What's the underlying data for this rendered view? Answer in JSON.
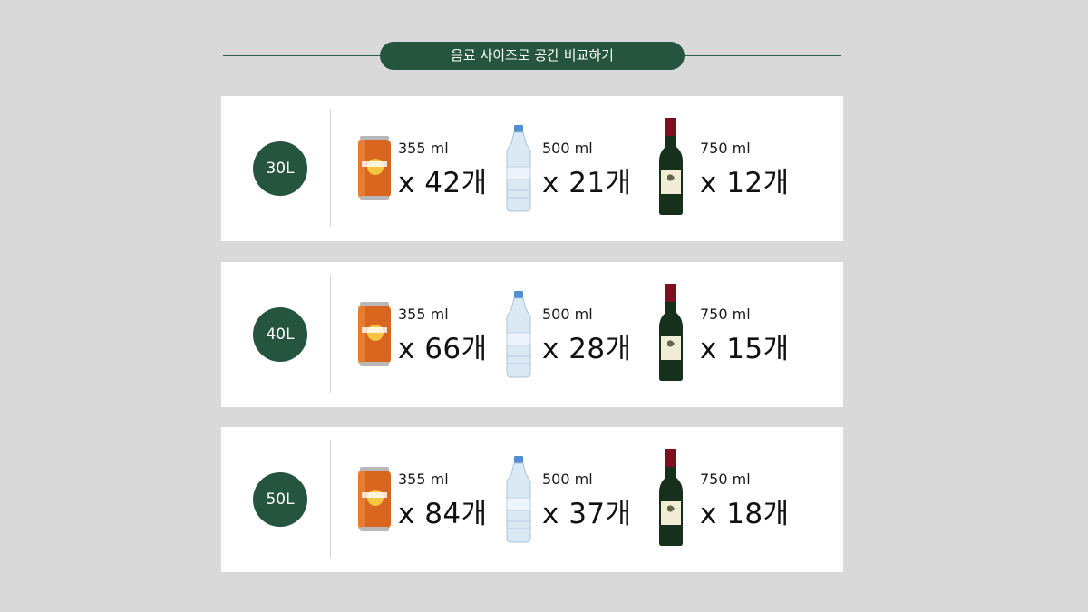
{
  "title": "음료 사이즈로 공간 비교하기",
  "colors": {
    "accent": "#25553f",
    "background": "#d9d9d9",
    "card": "#ffffff"
  },
  "drink_icons": [
    "orange-can-icon",
    "water-bottle-icon",
    "wine-bottle-icon"
  ],
  "rows": [
    {
      "capacity": "30L",
      "items": [
        {
          "volume": "355 ml",
          "count": "x 42개"
        },
        {
          "volume": "500 ml",
          "count": "x 21개"
        },
        {
          "volume": "750 ml",
          "count": "x 12개"
        }
      ]
    },
    {
      "capacity": "40L",
      "items": [
        {
          "volume": "355 ml",
          "count": "x 66개"
        },
        {
          "volume": "500 ml",
          "count": "x 28개"
        },
        {
          "volume": "750 ml",
          "count": "x 15개"
        }
      ]
    },
    {
      "capacity": "50L",
      "items": [
        {
          "volume": "355 ml",
          "count": "x 84개"
        },
        {
          "volume": "500 ml",
          "count": "x 37개"
        },
        {
          "volume": "750 ml",
          "count": "x 18개"
        }
      ]
    }
  ]
}
